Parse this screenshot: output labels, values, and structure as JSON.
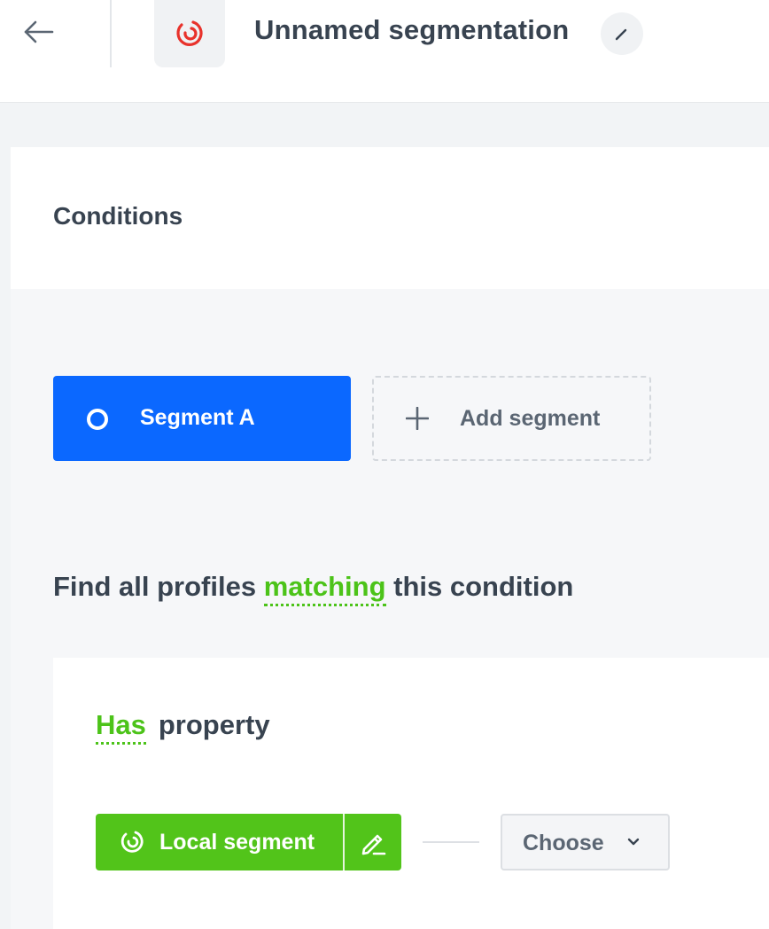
{
  "header": {
    "title": "Unnamed segmentation",
    "back_icon": "arrow-left-icon",
    "app_icon": "segmentation-icon",
    "edit_icon": "pencil-icon",
    "brand_color": "#e8322b"
  },
  "conditions": {
    "title": "Conditions",
    "segments": [
      {
        "label": "Segment A",
        "active": true,
        "color": "#0b68ff"
      }
    ],
    "add_segment_label": "Add segment"
  },
  "rule": {
    "prefix": "Find all profiles",
    "operator": "matching",
    "suffix": "this condition"
  },
  "condition": {
    "verb": "Has",
    "object": "property",
    "source_label": "Local segment",
    "source_color": "#52c41a",
    "choose_label": "Choose"
  }
}
